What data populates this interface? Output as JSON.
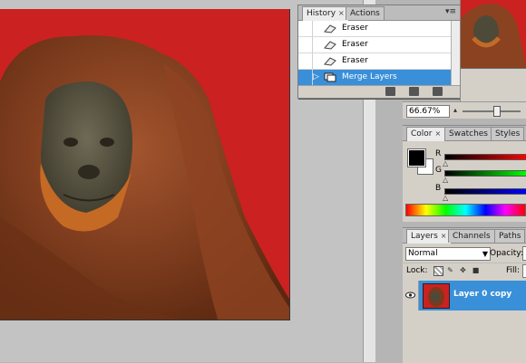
{
  "history_panel": {
    "tabs": [
      {
        "label": "History",
        "active": true,
        "close": "×"
      },
      {
        "label": "Actions",
        "active": false
      }
    ],
    "menu_icon": "panel-menu-icon",
    "items": [
      {
        "label": "Eraser",
        "icon": "eraser-icon",
        "selected": false
      },
      {
        "label": "Eraser",
        "icon": "eraser-icon",
        "selected": false
      },
      {
        "label": "Eraser",
        "icon": "eraser-icon",
        "selected": false
      },
      {
        "label": "Merge Layers",
        "icon": "merge-layers-icon",
        "selected": true
      }
    ],
    "footer_icons": [
      "new-document-from-state-icon",
      "create-snapshot-icon",
      "delete-state-icon"
    ]
  },
  "navigator": {
    "zoom": "66.67%"
  },
  "color_panel": {
    "tabs": [
      {
        "label": "Color",
        "active": true,
        "close": "×"
      },
      {
        "label": "Swatches",
        "active": false
      },
      {
        "label": "Styles",
        "active": false
      }
    ],
    "foreground": "#000000",
    "background": "#ffffff",
    "sliders": [
      {
        "label": "R",
        "color": "#cc0000",
        "value": 0
      },
      {
        "label": "G",
        "color": "#00aa00",
        "value": 0
      },
      {
        "label": "B",
        "color": "#0000cc",
        "value": 0
      }
    ]
  },
  "layers_panel": {
    "tabs": [
      {
        "label": "Layers",
        "active": true,
        "close": "×"
      },
      {
        "label": "Channels",
        "active": false
      },
      {
        "label": "Paths",
        "active": false
      }
    ],
    "blend_mode": "Normal",
    "opacity_label": "Opacity:",
    "lock_label": "Lock:",
    "fill_label": "Fill:",
    "layer": {
      "name": "Layer 0 copy",
      "visible": true,
      "selected": true
    }
  },
  "colors": {
    "document_bg": "#cc2121",
    "selection": "#3a8fd9"
  }
}
